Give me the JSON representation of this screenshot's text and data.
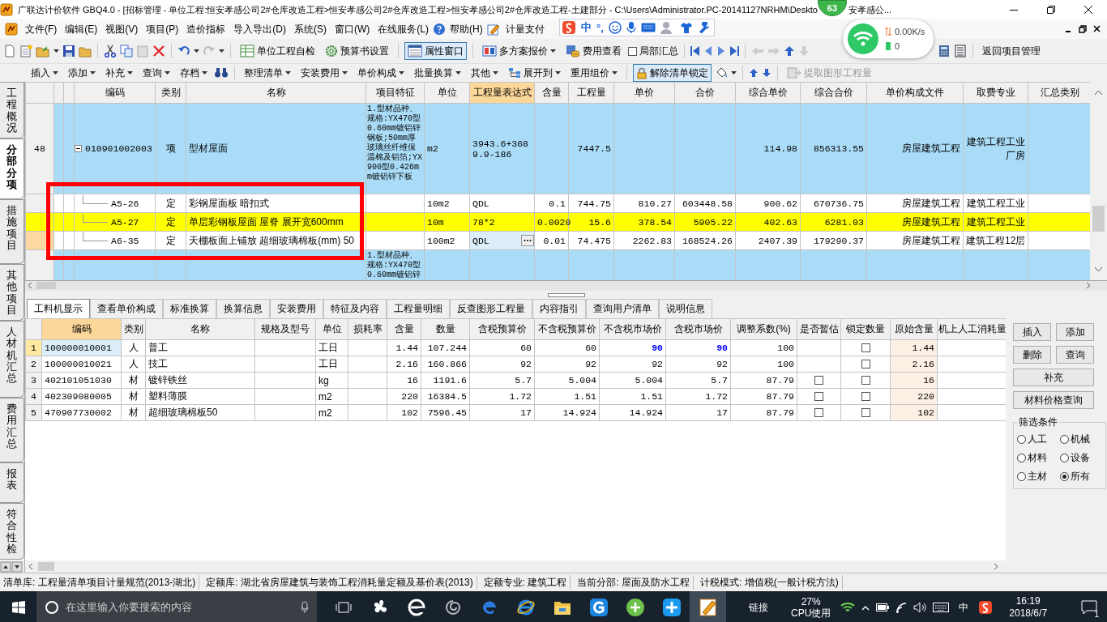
{
  "window": {
    "title": "广联达计价软件 GBQ4.0 - [招标管理 - 单位工程:恒安孝感公司2#仓库改造工程>恒安孝感公司2#仓库改造工程>恒安孝感公司2#仓库改造工程-土建部分 - C:\\Users\\Administrator.PC-20141127NRHM\\Deskto",
    "title_tail": "安孝感公..."
  },
  "badge": "63",
  "ime_bar": {
    "mode": "中",
    "punctuation": "°,"
  },
  "net_popup": {
    "speed": "0.00K/s",
    "count": "0"
  },
  "menu": [
    "文件(F)",
    "编辑(E)",
    "视图(V)",
    "项目(P)",
    "造价指标",
    "导入导出(D)",
    "系统(S)",
    "窗口(W)",
    "在线服务(L)",
    "帮助(H)",
    "计量支付"
  ],
  "toolbar": {
    "buttons": [
      {
        "label": "单位工程自检",
        "selected": false
      },
      {
        "label": "预算书设置",
        "selected": false
      },
      {
        "label": "属性窗口",
        "selected": true
      },
      {
        "label": "多方案报价",
        "selected": false
      },
      {
        "label": "费用查看",
        "selected": false
      }
    ],
    "partial_summary": {
      "label": "局部汇总",
      "checked": false
    },
    "return_label": "返回项目管理"
  },
  "edit_toolbar": [
    {
      "label": "插入",
      "kind": "dropdown"
    },
    {
      "label": "添加",
      "kind": "dropdown"
    },
    {
      "label": "补充",
      "kind": "dropdown"
    },
    {
      "label": "查询",
      "kind": "dropdown"
    },
    {
      "label": "存档",
      "kind": "dropdown"
    },
    {
      "label": "整理清单",
      "kind": "dropdown"
    },
    {
      "label": "安装费用",
      "kind": "dropdown"
    },
    {
      "label": "单价构成",
      "kind": "dropdown"
    },
    {
      "label": "批量换算",
      "kind": "dropdown"
    },
    {
      "label": "其他",
      "kind": "dropdown"
    },
    {
      "label": "展开到",
      "kind": "dropdown"
    },
    {
      "label": "重用组价",
      "kind": "dropdown"
    },
    {
      "label": "解除清单锁定",
      "kind": "toggle",
      "selected": true
    },
    {
      "label": "提取图形工程量",
      "kind": "action",
      "disabled": true
    }
  ],
  "side_tabs": [
    {
      "label": "工程概况",
      "selected": false
    },
    {
      "label": "分部分项",
      "selected": true
    },
    {
      "label": "措施项目",
      "selected": false
    },
    {
      "label": "其他项目",
      "selected": false
    },
    {
      "label": "人材机汇总",
      "selected": false
    },
    {
      "label": "费用汇总",
      "selected": false
    },
    {
      "label": "报表",
      "selected": false
    },
    {
      "label": "符合性检",
      "selected": false
    }
  ],
  "grid": {
    "columns": [
      {
        "label": "编码",
        "selected": false
      },
      {
        "label": "类别",
        "selected": false
      },
      {
        "label": "名称",
        "selected": false
      },
      {
        "label": "项目特征",
        "selected": false
      },
      {
        "label": "单位",
        "selected": false
      },
      {
        "label": "工程量表达式",
        "selected": true
      },
      {
        "label": "含量",
        "selected": false
      },
      {
        "label": "工程量",
        "selected": false
      },
      {
        "label": "单价",
        "selected": false
      },
      {
        "label": "合价",
        "selected": false
      },
      {
        "label": "综合单价",
        "selected": false
      },
      {
        "label": "综合合价",
        "selected": false
      },
      {
        "label": "单价构成文件",
        "selected": false
      },
      {
        "label": "取费专业",
        "selected": false
      },
      {
        "label": "汇总类别",
        "selected": false
      }
    ],
    "rows": [
      {
        "number": "48",
        "code": "010901002003",
        "type": "项",
        "name": "型材屋面",
        "features": "1.型材品种、规格:YX470型0.60mm镀铝锌钢板;50mm厚玻璃丝纤维保温棉及铝箔;YX900型0.426mm镀铝锌下板",
        "unit": "m2",
        "expression": "3943.6+3689.9-186",
        "quantity": "7447.5",
        "composite_price": "114.98",
        "composite_total": "856313.55",
        "price_file": "房屋建筑工程",
        "fee_category": "建筑工程工业厂房",
        "expanded": true,
        "children": [
          {
            "code": "A5-26",
            "type": "定",
            "name": "彩钢屋面板 暗扣式",
            "unit": "10m2",
            "expression": "QDL",
            "content": "0.1",
            "quantity": "744.75",
            "unit_price": "810.27",
            "total": "603448.58",
            "composite_price": "900.62",
            "composite_total": "670736.75",
            "price_file": "房屋建筑工程",
            "fee_category": "建筑工程工业",
            "selected": false,
            "current": false,
            "editing": false
          },
          {
            "code": "A5-27",
            "type": "定",
            "name": "单层彩钢板屋面 屋脊 展开宽600mm",
            "unit": "10m",
            "expression": "78*2",
            "content": "0.0020",
            "quantity": "15.6",
            "unit_price": "378.54",
            "total": "5905.22",
            "composite_price": "402.63",
            "composite_total": "6281.03",
            "price_file": "房屋建筑工程",
            "fee_category": "建筑工程工业",
            "selected": true,
            "current": false,
            "editing": false
          },
          {
            "code": "A6-35",
            "type": "定",
            "name": "天棚板面上铺放 超细玻璃棉板(mm) 50",
            "unit": "100m2",
            "expression": "QDL",
            "content": "0.01",
            "quantity": "74.475",
            "unit_price": "2262.83",
            "total": "168524.26",
            "composite_price": "2407.39",
            "composite_total": "179290.37",
            "price_file": "房屋建筑工程",
            "fee_category": "建筑工程12层",
            "selected": false,
            "current": true,
            "editing": true
          }
        ]
      },
      {
        "features": "1.型材品种、规格:YX470型0.60mm镀铝锌"
      }
    ]
  },
  "lower_tabs": [
    {
      "label": "工料机显示",
      "selected": true
    },
    {
      "label": "查看单价构成",
      "selected": false
    },
    {
      "label": "标准换算",
      "selected": false
    },
    {
      "label": "换算信息",
      "selected": false
    },
    {
      "label": "安装费用",
      "selected": false
    },
    {
      "label": "特征及内容",
      "selected": false
    },
    {
      "label": "工程量明细",
      "selected": false
    },
    {
      "label": "反查图形工程量",
      "selected": false
    },
    {
      "label": "内容指引",
      "selected": false
    },
    {
      "label": "查询用户清单",
      "selected": false
    },
    {
      "label": "说明信息",
      "selected": false
    }
  ],
  "materials": {
    "columns": [
      {
        "label": "编码",
        "selected": true
      },
      {
        "label": "类别",
        "selected": false
      },
      {
        "label": "名称",
        "selected": false
      },
      {
        "label": "规格及型号",
        "selected": false
      },
      {
        "label": "单位",
        "selected": false
      },
      {
        "label": "损耗率",
        "selected": false
      },
      {
        "label": "含量",
        "selected": false
      },
      {
        "label": "数量",
        "selected": false
      },
      {
        "label": "含税预算价",
        "selected": false
      },
      {
        "label": "不含税预算价",
        "selected": false
      },
      {
        "label": "不含税市场价",
        "selected": false
      },
      {
        "label": "含税市场价",
        "selected": false
      },
      {
        "label": "调整系数(%)",
        "selected": false
      },
      {
        "label": "是否暂估",
        "selected": false
      },
      {
        "label": "锁定数量",
        "selected": false
      },
      {
        "label": "原始含量",
        "selected": false
      },
      {
        "label": "机上人工消耗量",
        "selected": false
      }
    ],
    "rows": [
      {
        "number": "1",
        "code": "100000010001",
        "type": "人",
        "name": "普工",
        "unit": "工日",
        "content": "1.44",
        "amount": "107.244",
        "tax_budget": "60",
        "notax_budget": "60",
        "notax_market": "90",
        "tax_market": "90",
        "adjust": "100",
        "locked": false,
        "original": "1.44",
        "kind": "labor",
        "selected": true,
        "modified": true
      },
      {
        "number": "2",
        "code": "100000010021",
        "type": "人",
        "name": "技工",
        "unit": "工日",
        "content": "2.16",
        "amount": "160.866",
        "tax_budget": "92",
        "notax_budget": "92",
        "notax_market": "92",
        "tax_market": "92",
        "adjust": "100",
        "locked": false,
        "original": "2.16",
        "kind": "labor",
        "selected": false,
        "modified": false
      },
      {
        "number": "3",
        "code": "402101051030",
        "type": "材",
        "name": "镀锌铁丝",
        "unit": "kg",
        "content": "16",
        "amount": "1191.6",
        "tax_budget": "5.7",
        "notax_budget": "5.004",
        "notax_market": "5.004",
        "tax_market": "5.7",
        "adjust": "87.79",
        "estimate": false,
        "locked": false,
        "original": "16",
        "kind": "material",
        "selected": false,
        "modified": false
      },
      {
        "number": "4",
        "code": "402309080005",
        "type": "材",
        "name": "塑料薄膜",
        "unit": "m2",
        "content": "220",
        "amount": "16384.5",
        "tax_budget": "1.72",
        "notax_budget": "1.51",
        "notax_market": "1.51",
        "tax_market": "1.72",
        "adjust": "87.79",
        "estimate": false,
        "locked": false,
        "original": "220",
        "kind": "material",
        "selected": false,
        "modified": false
      },
      {
        "number": "5",
        "code": "470907730002",
        "type": "材",
        "name": "超细玻璃棉板50",
        "unit": "m2",
        "content": "102",
        "amount": "7596.45",
        "tax_budget": "17",
        "notax_budget": "14.924",
        "notax_market": "14.924",
        "tax_market": "17",
        "adjust": "87.79",
        "estimate": false,
        "locked": false,
        "original": "102",
        "kind": "material",
        "selected": false,
        "modified": false
      }
    ]
  },
  "side_buttons": [
    "插入",
    "添加",
    "删除",
    "查询",
    "补充",
    "材料价格查询"
  ],
  "filter": {
    "title": "筛选条件",
    "options": [
      {
        "label": "人工",
        "selected": false
      },
      {
        "label": "机械",
        "selected": false
      },
      {
        "label": "材料",
        "selected": false
      },
      {
        "label": "设备",
        "selected": false
      },
      {
        "label": "主材",
        "selected": false
      },
      {
        "label": "所有",
        "selected": true
      }
    ]
  },
  "status_bar": [
    "清单库: 工程量清单项目计量规范(2013-湖北)",
    "定额库: 湖北省房屋建筑与装饰工程消耗量定额及基价表(2013)",
    "定额专业: 建筑工程",
    "当前分部: 屋面及防水工程",
    "计税模式: 增值税(一般计税方法)"
  ],
  "taskbar": {
    "search_placeholder": "在这里输入你要搜索的内容",
    "link_label": "链接",
    "cpu": "27%",
    "cpu_label": "CPU使用",
    "ime": "中",
    "time": "16:19",
    "date": "2018/6/7",
    "notifications": "1"
  }
}
